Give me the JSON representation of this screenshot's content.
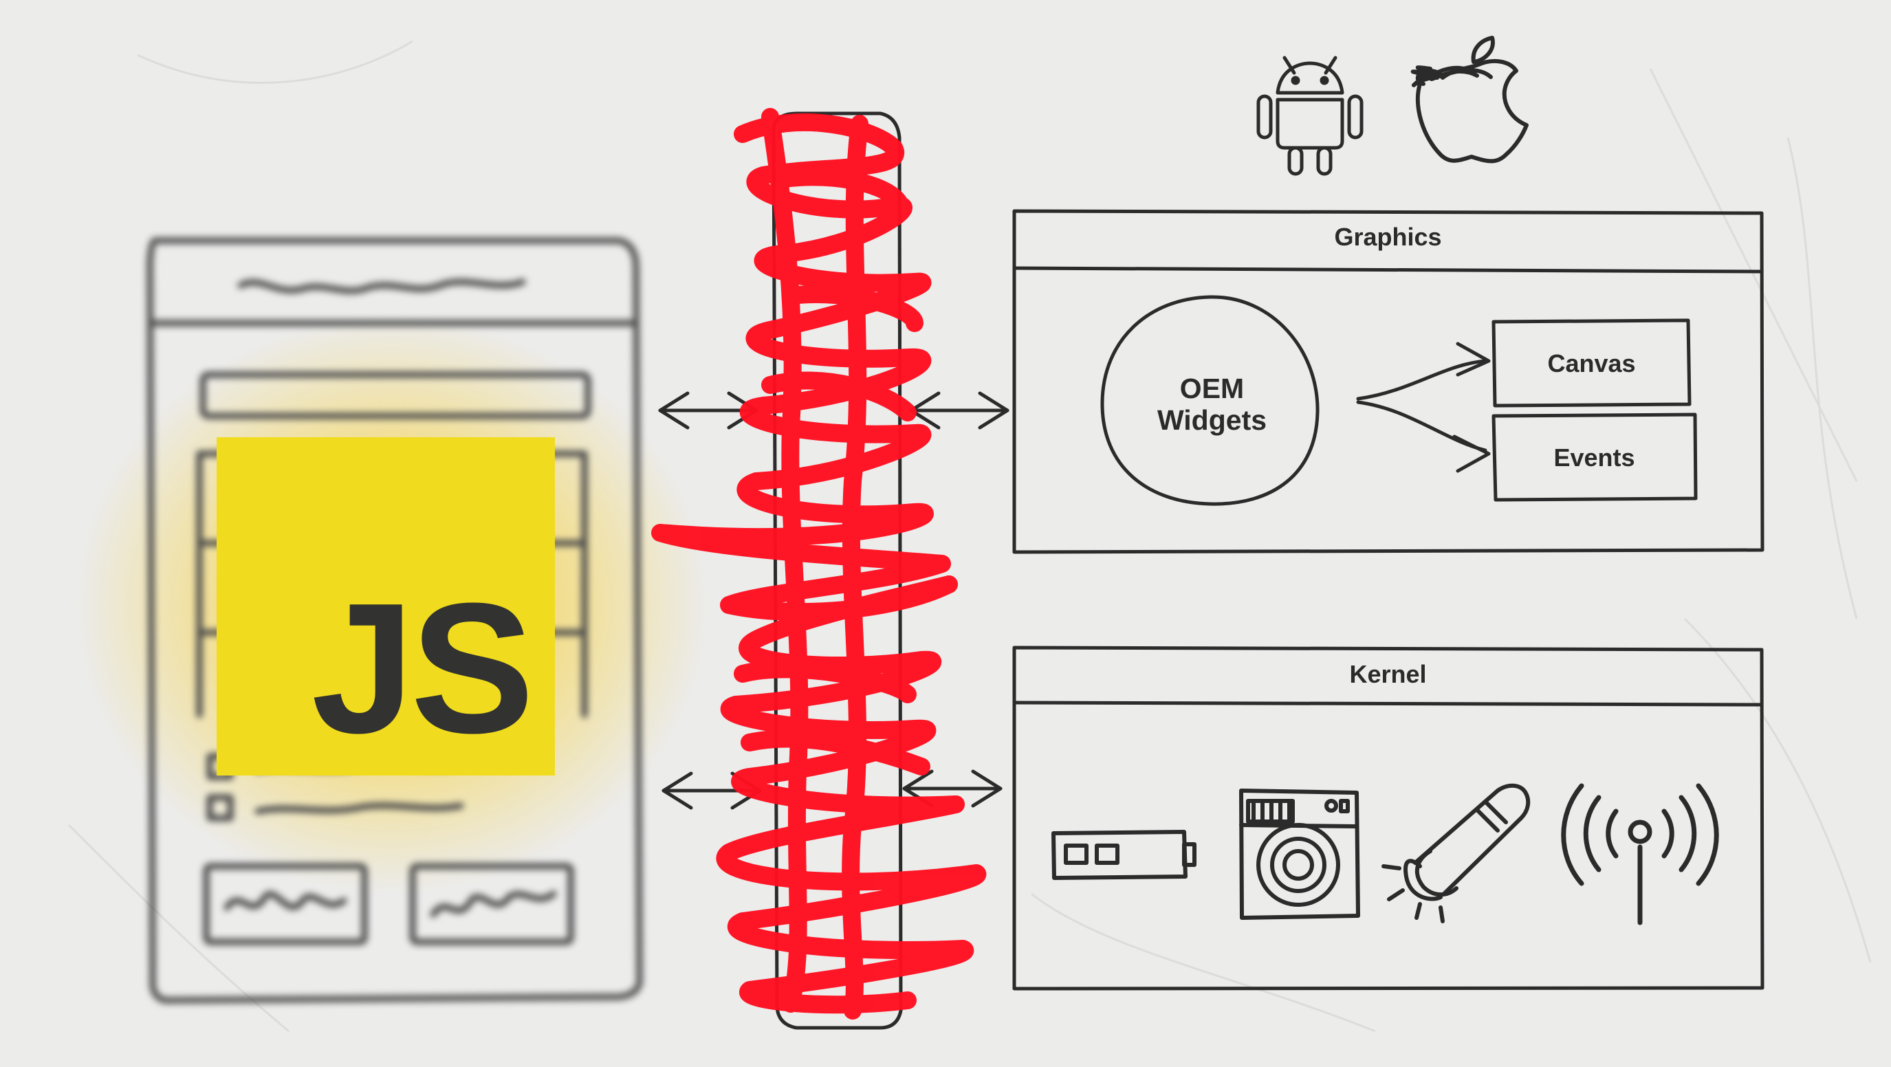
{
  "colors": {
    "background": "#ececeb",
    "ink": "#2b2b2b",
    "js_yellow": "#f0db1e",
    "js_text": "#323330",
    "scribble_red": "#ff1020",
    "glow": "#f6c200"
  },
  "js_badge": {
    "text": "JS"
  },
  "graphics_panel": {
    "title": "Graphics",
    "widgets_label_line1": "OEM",
    "widgets_label_line2": "Widgets",
    "targets": [
      "Canvas",
      "Events"
    ]
  },
  "kernel_panel": {
    "title": "Kernel",
    "icons": [
      "battery-icon",
      "camera-icon",
      "flashlight-icon",
      "antenna-icon"
    ]
  },
  "platform_icons": [
    "android-icon",
    "apple-icon"
  ]
}
